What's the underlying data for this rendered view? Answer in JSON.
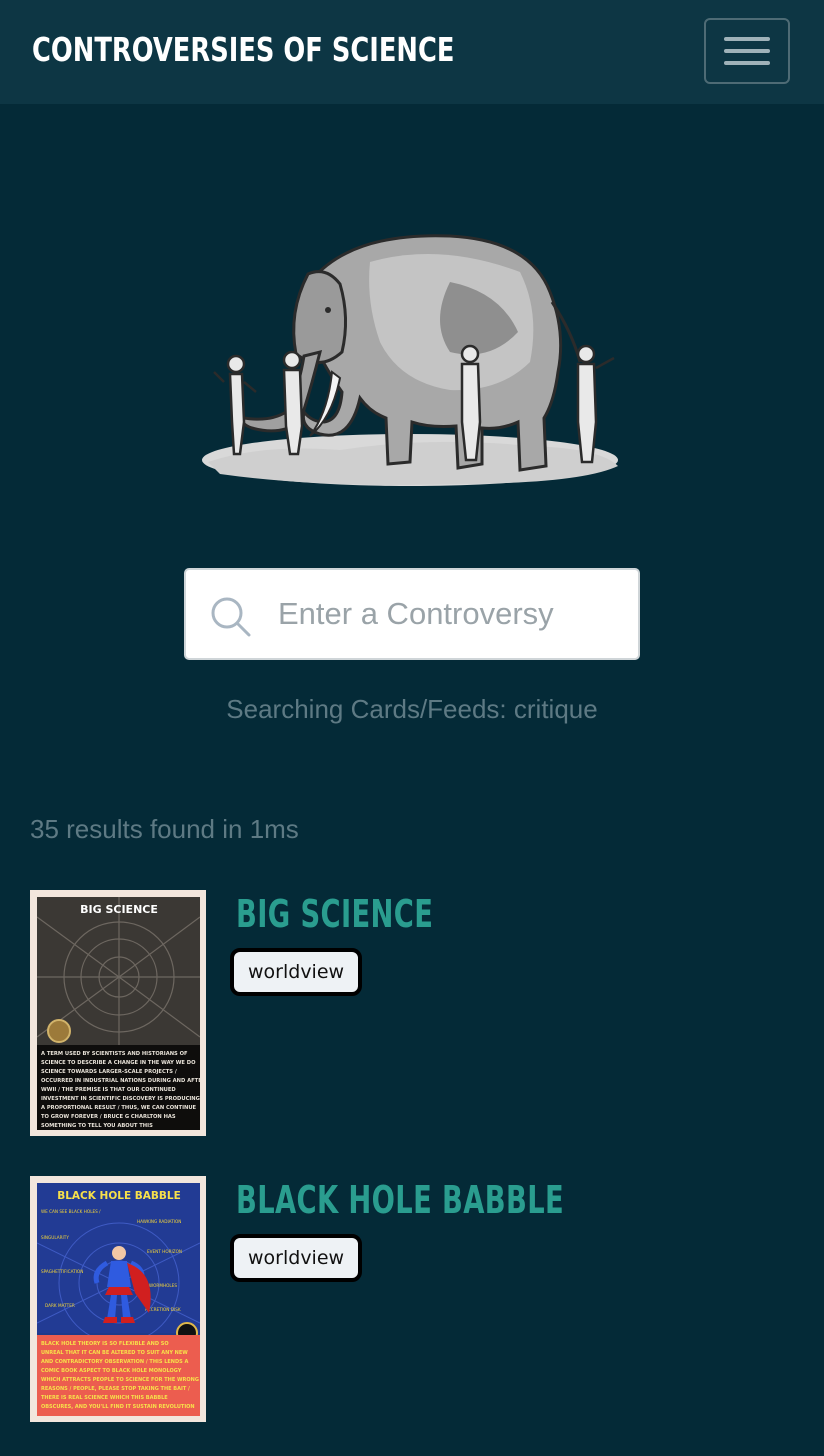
{
  "app": {
    "brand": "CONTROVERSIES OF SCIENCE"
  },
  "navbar": {
    "menu_icon": "hamburger-menu-icon"
  },
  "hero": {
    "image": "elephant-and-blind-men-illustration"
  },
  "search": {
    "placeholder": "Enter a Controversy",
    "value": "",
    "icon": "search-icon",
    "status": "Searching Cards/Feeds: critique"
  },
  "results": {
    "summary": "35 results found in 1ms",
    "items": [
      {
        "title": "BIG SCIENCE",
        "tag": "worldview",
        "thumbnail_heading": "BIG SCIENCE",
        "thumbnail_caption": "A TERM USED BY SCIENTISTS AND HISTORIANS OF SCIENCE TO DESCRIBE A CHANGE IN THE WAY WE DO SCIENCE TOWARDS LARGER-SCALE PROJECTS / OCCURRED IN INDUSTRIAL NATIONS DURING AND AFTER WWII / THE PREMISE IS THAT OUR CONTINUED INVESTMENT IN SCIENTIFIC DISCOVERY IS PRODUCING A PROPORTIONAL RESULT / THUS, WE CAN CONTINUE TO GROW FOREVER / BRUCE G CHARLTON HAS SOMETHING TO TELL YOU ABOUT THIS"
      },
      {
        "title": "BLACK HOLE BABBLE",
        "tag": "worldview",
        "thumbnail_heading": "BLACK HOLE BABBLE",
        "thumbnail_caption": "BLACK HOLE THEORY IS SO FLEXIBLE AND SO UNREAL THAT IT CAN BE ALTERED TO SUIT ANY NEW AND CONTRADICTORY OBSERVATION / THIS LENDS A COMIC BOOK ASPECT TO BLACK HOLE MONOLOGY WHICH ATTRACTS PEOPLE TO SCIENCE FOR THE WRONG REASONS / PEOPLE, PLEASE STOP TAKING THE BAIT / THERE IS REAL SCIENCE WHICH THIS BABBLE OBSCURES, AND YOU'LL FIND IT SUSTAIN REVOLUTION"
      }
    ]
  },
  "colors": {
    "background": "#042a37",
    "navbar": "#0d3644",
    "accent_title": "#2a9d8f",
    "muted_text": "#5e7a84"
  }
}
